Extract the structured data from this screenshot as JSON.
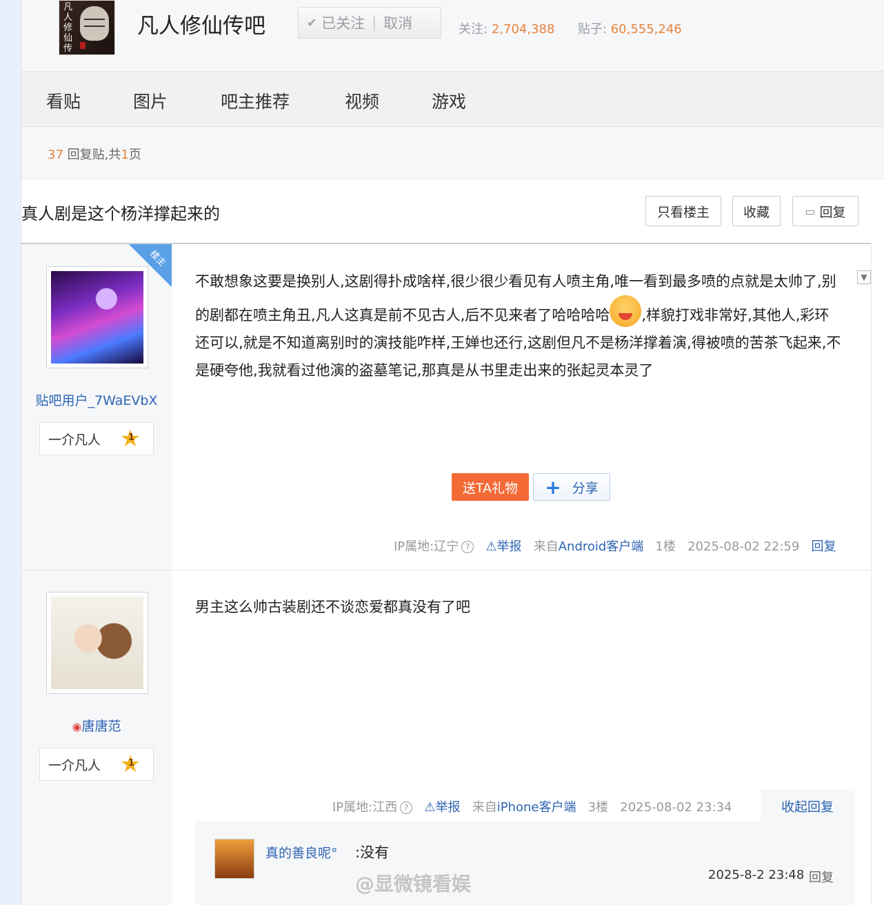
{
  "header": {
    "forum_name": "凡人修仙传吧",
    "logo_text": "凡人修仙传",
    "follow_label": "已关注",
    "cancel_label": "取消",
    "followers_label": "关注:",
    "followers_count": "2,704,388",
    "posts_label": "贴子:",
    "posts_count": "60,555,246"
  },
  "nav": {
    "tabs": [
      "看贴",
      "图片",
      "吧主推荐",
      "视频",
      "游戏"
    ]
  },
  "thread": {
    "reply_count": "37",
    "reply_label": "回复贴,共",
    "pages": "1",
    "pages_label": "页",
    "title": "真人剧是这个杨洋撑起来的",
    "btn_only_op": "只看楼主",
    "btn_collect": "收藏",
    "btn_reply": "回复"
  },
  "posts": [
    {
      "badge": "楼主",
      "username": "贴吧用户_7WaEVbX",
      "rank_title": "一介凡人",
      "level": "1",
      "text_a": "不敢想象这要是换别人,这剧得扑成啥样,很少很少看见有人喷主角,唯一看到最多喷的点就是太帅了,别的剧都在喷主角丑,凡人这真是前不见古人,后不见来者了哈哈哈哈",
      "text_b": ",样貌打戏非常好,其他人,彩环还可以,就是不知道离别时的演技能咋样,王婵也还行,这剧但凡不是杨洋撑着演,得被喷的苦茶飞起来,不是硬夸他,我就看过他演的盗墓笔记,那真是从书里走出来的张起灵本灵了",
      "gift_label": "送TA礼物",
      "share_label": "分享",
      "ip": "IP属地:辽宁",
      "report": "举报",
      "from_prefix": "来自",
      "client": "Android客户端",
      "floor": "1楼",
      "time": "2025-08-02 22:59",
      "reply_label": "回复"
    },
    {
      "username": "唐唐范",
      "rank_title": "一介凡人",
      "level": "1",
      "text": "男主这么帅古装剧还不谈恋爱都真没有了吧",
      "ip": "IP属地:江西",
      "report": "举报",
      "from_prefix": "来自",
      "client": "iPhone客户端",
      "floor": "3楼",
      "time": "2025-08-02 23:34",
      "collapse_label": "收起回复",
      "sub_replies": [
        {
          "username": "真的善良呢°",
          "text": ":没有",
          "time": "2025-8-2 23:48",
          "reply_label": "回复"
        }
      ]
    }
  ],
  "watermark": "@显微镜看娱",
  "colors": {
    "accent_orange": "#e8843b",
    "link_blue": "#2d64b3",
    "gift_orange": "#f46a35"
  }
}
